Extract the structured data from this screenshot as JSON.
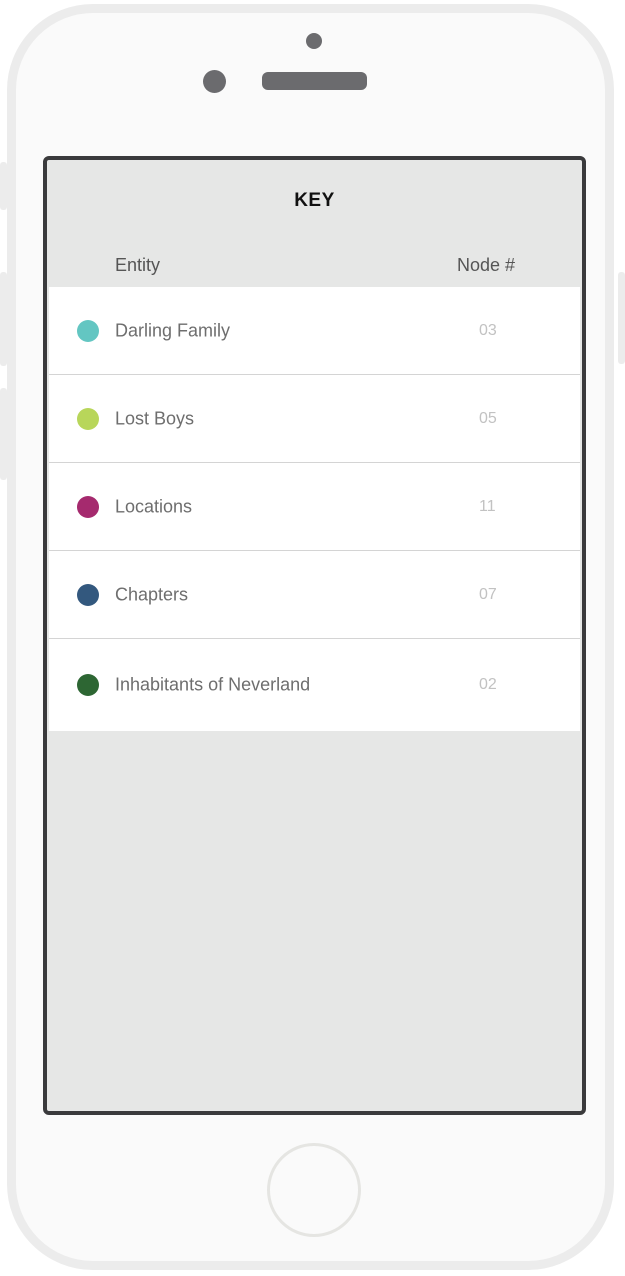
{
  "key_panel": {
    "title": "KEY",
    "headers": {
      "entity": "Entity",
      "node": "Node #"
    },
    "rows": [
      {
        "label": "Darling Family",
        "count": "03",
        "color": "#63c6c2"
      },
      {
        "label": "Lost Boys",
        "count": "05",
        "color": "#b8d65a"
      },
      {
        "label": "Locations",
        "count": "11",
        "color": "#a52a6e"
      },
      {
        "label": "Chapters",
        "count": "07",
        "color": "#33587e"
      },
      {
        "label": "Inhabitants of Neverland",
        "count": "02",
        "color": "#2d6633"
      }
    ]
  }
}
